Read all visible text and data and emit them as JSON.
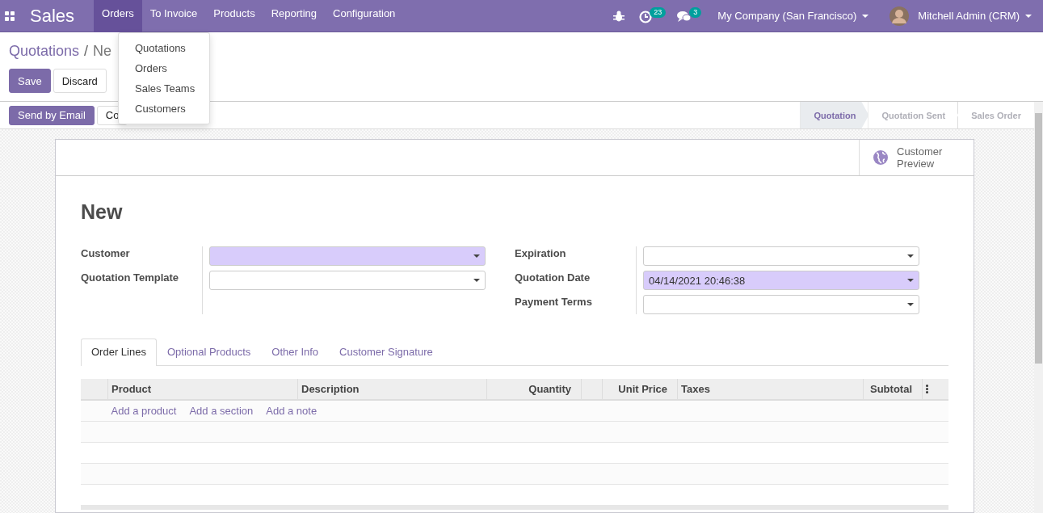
{
  "navbar": {
    "app_title": "Sales",
    "menus": [
      {
        "label": "Orders",
        "selected": true
      },
      {
        "label": "To Invoice",
        "selected": false
      },
      {
        "label": "Products",
        "selected": false
      },
      {
        "label": "Reporting",
        "selected": false
      },
      {
        "label": "Configuration",
        "selected": false
      }
    ],
    "activity_count": "23",
    "message_count": "3",
    "company": "My Company (San Francisco)",
    "user": "Mitchell Admin (CRM)"
  },
  "dropdown": {
    "items": [
      "Quotations",
      "Orders",
      "Sales Teams",
      "Customers"
    ]
  },
  "breadcrumb": {
    "separator": "/",
    "items": [
      {
        "label": "Quotations",
        "kind": "link"
      },
      {
        "label": "Ne",
        "kind": "current"
      }
    ]
  },
  "buttons": [
    {
      "label": "Save",
      "kind": "primary"
    },
    {
      "label": "Discard",
      "kind": "secondary"
    }
  ],
  "action_buttons": [
    {
      "label": "Send by Email",
      "kind": "primary"
    },
    {
      "label": "Co",
      "kind": "secondary"
    }
  ],
  "statusbar": [
    {
      "label": "Quotation",
      "selected": true
    },
    {
      "label": "Quotation Sent",
      "selected": false
    },
    {
      "label": "Sales Order",
      "selected": false
    }
  ],
  "sheet": {
    "preview_button": "Customer Preview",
    "title": "New",
    "left_fields": [
      {
        "label": "Customer",
        "required": true
      },
      {
        "label": "Quotation Template",
        "required": false
      }
    ],
    "right_fields": [
      {
        "label": "Expiration",
        "required": false
      },
      {
        "label": "Quotation Date",
        "value": "04/14/2021 20:46:38",
        "required": true
      },
      {
        "label": "Payment Terms",
        "required": false
      }
    ],
    "tabs": [
      {
        "label": "Order Lines",
        "selected": true
      },
      {
        "label": "Optional Products",
        "selected": false
      },
      {
        "label": "Other Info",
        "selected": false
      },
      {
        "label": "Customer Signature",
        "selected": false
      }
    ],
    "table": {
      "columns": [
        {
          "kind": "handle"
        },
        {
          "kind": "text",
          "label": "Product"
        },
        {
          "kind": "text",
          "label": "Description"
        },
        {
          "kind": "number",
          "label": "Quantity"
        },
        {
          "kind": "spacer"
        },
        {
          "kind": "number",
          "label": "Unit Price"
        },
        {
          "kind": "text",
          "label": "Taxes"
        },
        {
          "kind": "number",
          "label": "Subtotal"
        },
        {
          "kind": "options"
        }
      ],
      "add_links": [
        "Add a product",
        "Add a section",
        "Add a note"
      ]
    }
  }
}
